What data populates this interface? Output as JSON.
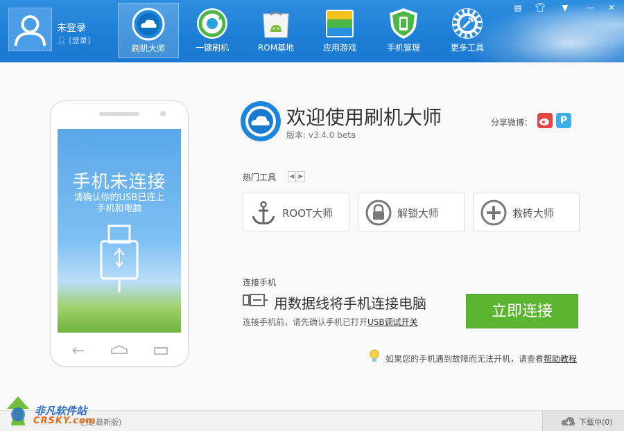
{
  "topbar": {
    "user": {
      "name": "未登录",
      "login": "[登录]"
    },
    "nav": [
      {
        "label": "刷机大师",
        "icon": "cloud-icon"
      },
      {
        "label": "一键刷机",
        "icon": "refresh-icon"
      },
      {
        "label": "ROM基地",
        "icon": "android-bag-icon"
      },
      {
        "label": "应用游戏",
        "icon": "apps-icon"
      },
      {
        "label": "手机管理",
        "icon": "shield-phone-icon"
      },
      {
        "label": "更多工具",
        "icon": "wrench-gear-icon"
      }
    ],
    "controls": [
      "feedback-icon",
      "skin-icon",
      "menu-icon",
      "minimize-icon",
      "close-icon"
    ]
  },
  "phone": {
    "title": "手机未连接",
    "subtitle_line1": "请确认你的USB已连上",
    "subtitle_line2": "手机和电脑"
  },
  "header": {
    "welcome": "欢迎使用刷机大师",
    "version": "版本: v3.4.0 beta",
    "share_label": "分享微博："
  },
  "hot_tools": {
    "label": "热门工具",
    "items": [
      {
        "label": "ROOT大师",
        "icon": "anchor-icon"
      },
      {
        "label": "解锁大师",
        "icon": "lock-icon"
      },
      {
        "label": "救砖大师",
        "icon": "plus-circle-icon"
      }
    ]
  },
  "connect": {
    "label": "连接手机",
    "title": "用数据线将手机连接电脑",
    "hint_prefix": "连接手机前，请先确认手机已打开",
    "hint_link": "USB调试开关",
    "button": "立即连接"
  },
  "help": {
    "text_prefix": "如果您的手机遇到故障而无法开机，请查看",
    "link": "帮助教程"
  },
  "status": {
    "text": "已是最新版)",
    "download": "下载中(0)"
  },
  "watermark": {
    "line1": "非凡软件站",
    "line2": "CRSKY.com"
  },
  "colors": {
    "brand_blue": "#1e7fd6",
    "connect_green": "#5cb531"
  }
}
